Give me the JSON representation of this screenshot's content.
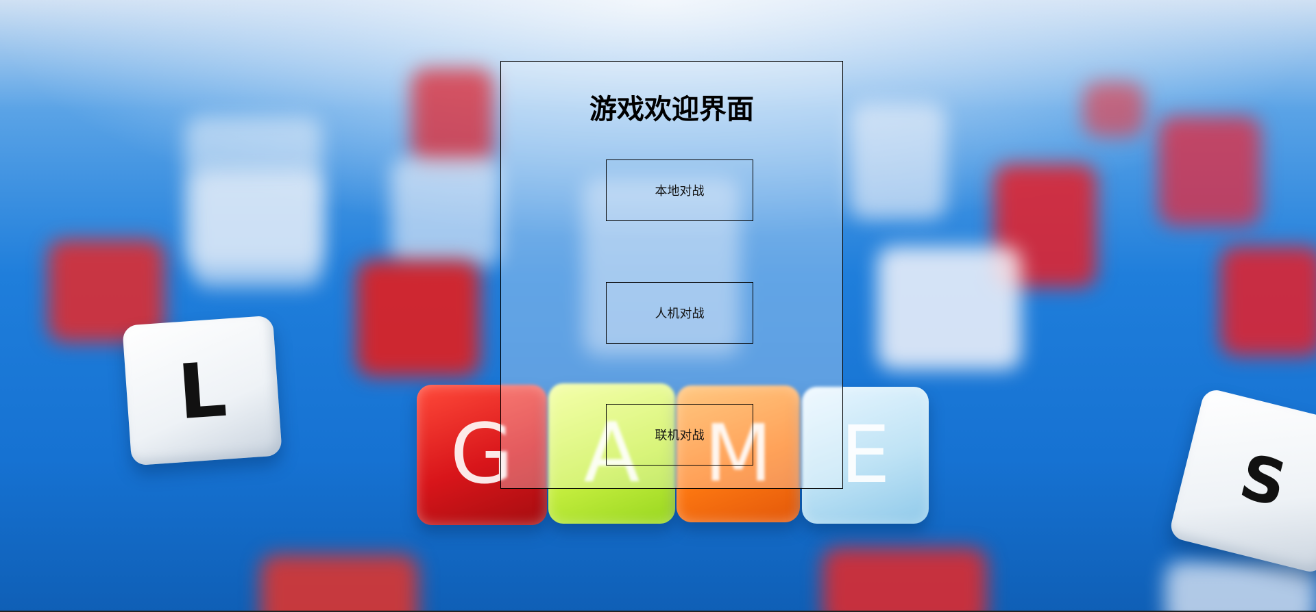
{
  "page": {
    "title": "游戏欢迎界面"
  },
  "menu": {
    "local_battle": "本地对战",
    "ai_battle": "人机对战",
    "online_battle": "联机对战"
  },
  "background": {
    "cube_letters": [
      "G",
      "A",
      "M",
      "E"
    ],
    "colors": {
      "sky": "#1f7edb",
      "cube_red": "#e0201e",
      "cube_yellow": "#d8f24a",
      "cube_orange": "#ff7a12",
      "cube_clear": "#bfe3f5"
    }
  }
}
